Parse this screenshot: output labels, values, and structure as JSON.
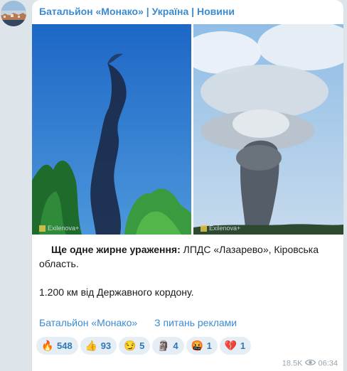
{
  "channel": {
    "name": "Батальйон «Монако» | Україна | Новини"
  },
  "photos": {
    "left": {
      "watermark": "Exilenova+"
    },
    "right": {
      "watermark": "Exilenova+"
    }
  },
  "post": {
    "bold": "Ще одне жирне ураження:",
    "line1": " ЛПДС «Лазарево», Кіровська область.",
    "line2": "1.200 км від Державного кордону."
  },
  "links": {
    "channel": "Батальйон «Монако»",
    "ads": "З питань реклами"
  },
  "reactions": [
    {
      "icon": "fire-emoji-icon",
      "glyph": "🔥",
      "count": "548"
    },
    {
      "icon": "thumbs-up-emoji-icon",
      "glyph": "👍",
      "count": "93"
    },
    {
      "icon": "smirk-emoji-icon",
      "glyph": "😏",
      "count": "5"
    },
    {
      "icon": "moai-emoji-icon",
      "glyph": "🗿",
      "count": "4"
    },
    {
      "icon": "cursing-face-emoji-icon",
      "glyph": "🤬",
      "count": "1"
    },
    {
      "icon": "broken-heart-emoji-icon",
      "glyph": "💔",
      "count": "1"
    }
  ],
  "meta": {
    "views": "18.5K",
    "time": "06:34"
  }
}
